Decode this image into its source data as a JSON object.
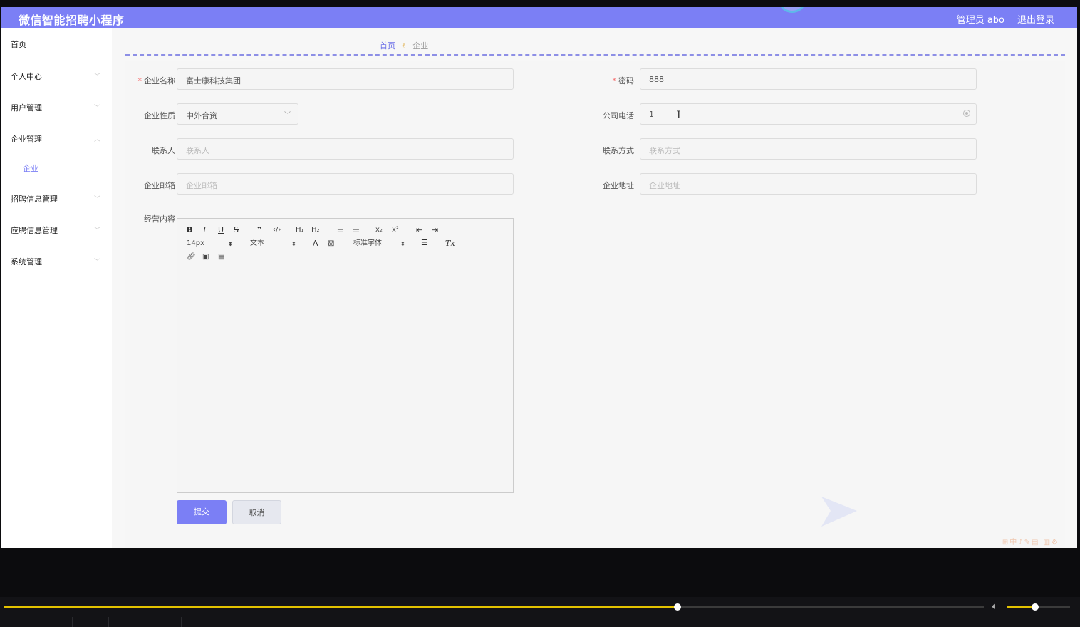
{
  "header": {
    "title": "微信智能招聘小程序",
    "admin_label": "管理员 abo",
    "logout_label": "退出登录"
  },
  "sidebar": {
    "items": [
      {
        "label": "首页"
      },
      {
        "label": "个人中心"
      },
      {
        "label": "用户管理"
      },
      {
        "label": "企业管理"
      },
      {
        "label": "企业"
      },
      {
        "label": "招聘信息管理"
      },
      {
        "label": "应聘信息管理"
      },
      {
        "label": "系统管理"
      }
    ]
  },
  "breadcrumb": {
    "home": "首页",
    "current": "企业"
  },
  "form": {
    "company_name": {
      "label": "企业名称",
      "required": "*",
      "value": "富士康科技集团"
    },
    "password": {
      "label": "密码",
      "required": "*",
      "value": "888"
    },
    "company_nature": {
      "label": "企业性质",
      "value": "中外合资"
    },
    "company_phone": {
      "label": "公司电话",
      "value": "1"
    },
    "contact_person": {
      "label": "联系人",
      "placeholder": "联系人"
    },
    "contact_method": {
      "label": "联系方式",
      "placeholder": "联系方式"
    },
    "company_email": {
      "label": "企业邮箱",
      "placeholder": "企业邮箱"
    },
    "company_address": {
      "label": "企业地址",
      "placeholder": "企业地址"
    },
    "business_content": {
      "label": "经营内容"
    }
  },
  "editor": {
    "font_size": "14px",
    "paragraph": "文本",
    "font_family": "标准字体",
    "bold": "B",
    "italic": "I",
    "underline": "U",
    "strike": "S",
    "quote": "❞",
    "code": "‹/›",
    "h1": "H₁",
    "h2": "H₂",
    "sub": "x₂",
    "sup": "x²",
    "clear": "Tx"
  },
  "buttons": {
    "submit": "提交",
    "cancel": "取消"
  },
  "player": {
    "progress": 0.687,
    "volume": 0.44
  },
  "colors": {
    "accent": "#7b7ff5",
    "required": "#f56c6c",
    "player_bar": "#e3c200"
  },
  "icons": {
    "breadcrumb_separator": "hand-icon",
    "chevron": "chevron-down-icon"
  }
}
